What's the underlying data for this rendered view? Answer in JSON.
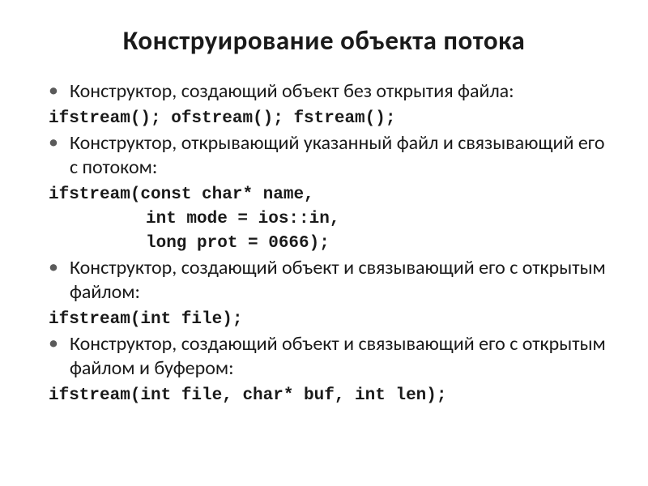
{
  "title": "Конструирование объекта потока",
  "items": [
    {
      "type": "bullet",
      "text": "Конструктор, создающий объект без открытия файла:"
    },
    {
      "type": "code",
      "indent": 0,
      "text": "ifstream(); ofstream(); fstream();"
    },
    {
      "type": "bullet",
      "text": "Конструктор, открывающий указанный файл и связывающий его с потоком:"
    },
    {
      "type": "code",
      "indent": 0,
      "text": "ifstream(const char* name,"
    },
    {
      "type": "code",
      "indent": 1,
      "text": "int mode = ios::in,"
    },
    {
      "type": "code",
      "indent": 1,
      "text": "long prot = 0666);"
    },
    {
      "type": "bullet",
      "text": "Конструктор, создающий объект и связывающий его с открытым файлом:"
    },
    {
      "type": "code",
      "indent": 0,
      "text": "ifstream(int file);"
    },
    {
      "type": "bullet",
      "text": "Конструктор, создающий объект и связывающий его с открытым файлом и буфером:"
    },
    {
      "type": "code",
      "indent": 0,
      "text": "ifstream(int file, char* buf, int len);"
    }
  ]
}
